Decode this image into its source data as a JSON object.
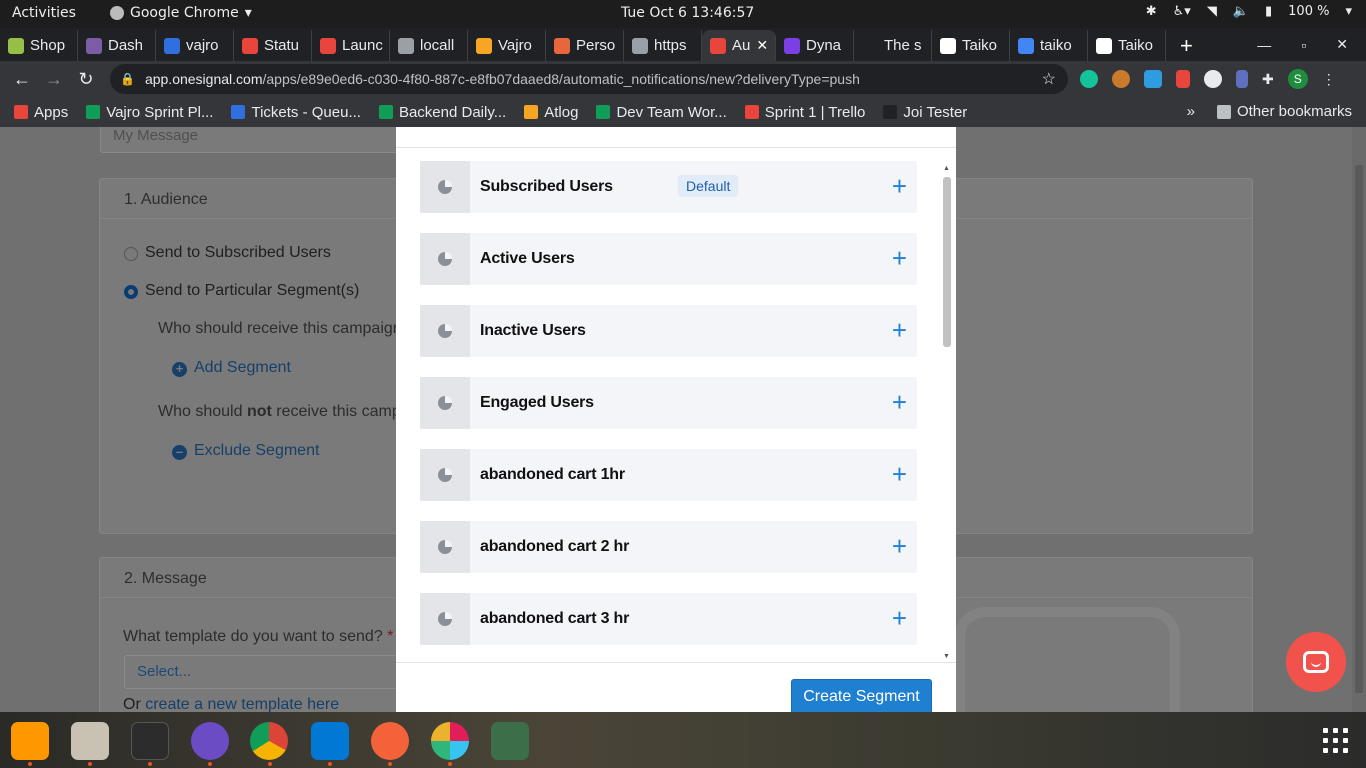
{
  "system_bar": {
    "activities": "Activities",
    "app_name": "Google Chrome",
    "clock": "Tue Oct  6  13:46:57",
    "battery": "100 %"
  },
  "tabs": [
    {
      "title": "Shop",
      "color": "#95bf47"
    },
    {
      "title": "Dash",
      "color": "#7b5ea7"
    },
    {
      "title": "vajro",
      "color": "#2f6fe0"
    },
    {
      "title": "Statu",
      "color": "#e8453c"
    },
    {
      "title": "Launc",
      "color": "#e8453c"
    },
    {
      "title": "locall",
      "color": "#9aa0a6"
    },
    {
      "title": "Vajro",
      "color": "#f6a623"
    },
    {
      "title": "Perso",
      "color": "#e8663c"
    },
    {
      "title": "https",
      "color": "#9aa0a6"
    },
    {
      "title": "Au",
      "color": "#e8453c",
      "active": true
    },
    {
      "title": "Dyna",
      "color": "#7b3fe4"
    },
    {
      "title": "The s",
      "color": "#202124"
    },
    {
      "title": "Taiko",
      "color": "#ffffff"
    },
    {
      "title": "taiko",
      "color": "#4285f4"
    },
    {
      "title": "Taiko",
      "color": "#ffffff"
    }
  ],
  "address_bar": {
    "host": "app.onesignal.com",
    "path": "/apps/e89e0ed6-c030-4f80-887c-e8fb07daaed8/automatic_notifications/new?deliveryType=push"
  },
  "bookmarks": [
    {
      "label": "Apps",
      "color": "#e8453c"
    },
    {
      "label": "Vajro Sprint Pl...",
      "color": "#0f9d58"
    },
    {
      "label": "Tickets - Queu...",
      "color": "#2f6fe0"
    },
    {
      "label": "Backend Daily...",
      "color": "#0f9d58"
    },
    {
      "label": "Atlog",
      "color": "#f6a623"
    },
    {
      "label": "Dev Team Wor...",
      "color": "#0f9d58"
    },
    {
      "label": "Sprint 1 | Trello",
      "color": "#e8453c"
    },
    {
      "label": "Joi Tester",
      "color": "#202124"
    }
  ],
  "other_bookmarks": "Other bookmarks",
  "background_page": {
    "message_placeholder": "My Message",
    "audience_header": "1. Audience",
    "radio_subscribed": "Send to Subscribed Users",
    "radio_segments": "Send to Particular Segment(s)",
    "who_receive": "Who should receive this campaign",
    "add_segment": "Add Segment",
    "who_not_prefix": "Who should ",
    "who_not_bold": "not",
    "who_not_suffix": " receive this camp",
    "exclude_segment": "Exclude Segment",
    "message_header": "2. Message",
    "template_question": "What template do you want to send?",
    "required_mark": "*",
    "select_placeholder": "Select...",
    "or_text": "Or ",
    "create_template_link": "create a new template here"
  },
  "modal": {
    "segments": [
      {
        "name": "Subscribed Users",
        "badge": "Default"
      },
      {
        "name": "Active Users"
      },
      {
        "name": "Inactive Users"
      },
      {
        "name": "Engaged Users"
      },
      {
        "name": "abandoned cart 1hr"
      },
      {
        "name": "abandoned cart 2 hr"
      },
      {
        "name": "abandoned cart 3 hr"
      }
    ],
    "create_button": "Create Segment"
  }
}
